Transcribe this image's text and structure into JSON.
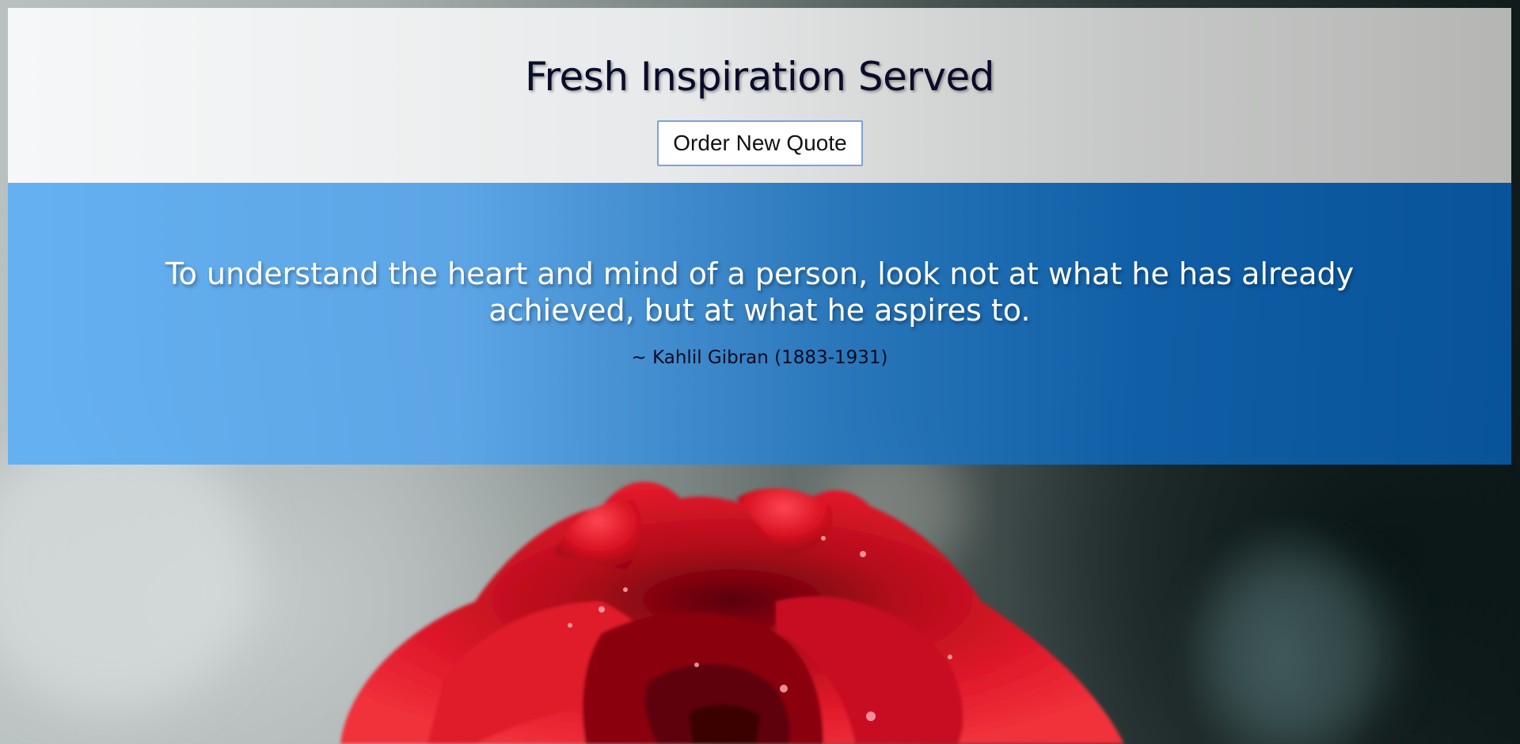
{
  "header": {
    "title": "Fresh Inspiration Served",
    "button_label": "Order New Quote"
  },
  "quote": {
    "text": "To understand the heart and mind of a person, look not at what he has already achieved, but at what he aspires to.",
    "author": "~ Kahlil Gibran (1883-1931)"
  },
  "colors": {
    "header_bg": "#f5f6f7",
    "quote_bg_left": "#62b0f2",
    "quote_bg_right": "#08549c",
    "title_text": "#0b0b2a",
    "quote_text": "#ffffff",
    "author_text": "#0a0a20",
    "rose": "#d01020"
  },
  "background": {
    "icon": "rose-photo"
  }
}
